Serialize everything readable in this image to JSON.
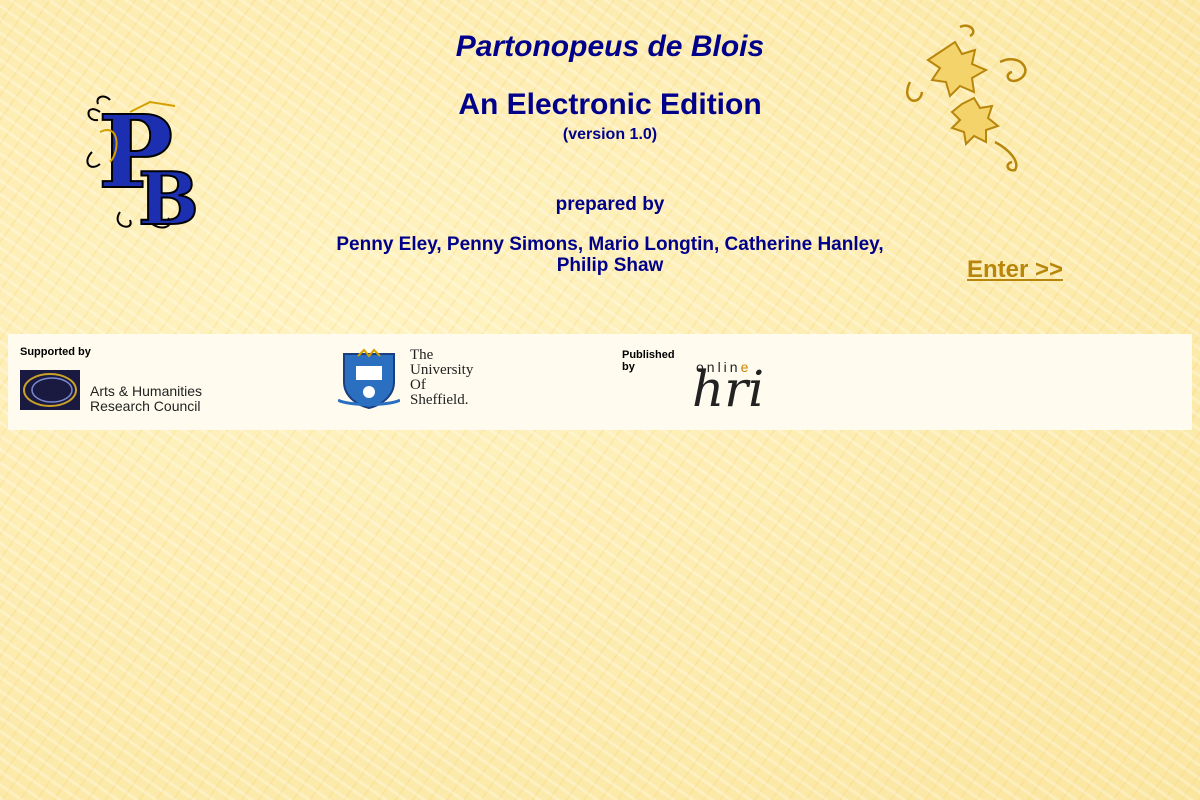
{
  "header": {
    "title": "Partonopeus de Blois",
    "subtitle": "An Electronic Edition",
    "version": "(version 1.0)",
    "prepared_by": "prepared by",
    "authors_line1": "Penny Eley, Penny Simons, Mario Longtin, Catherine Hanley,",
    "authors_line2": "Philip Shaw"
  },
  "nav": {
    "enter_label": "Enter >>"
  },
  "logos": {
    "pb": "PB",
    "vine": "vine-ornament-icon"
  },
  "footer": {
    "supported_label": "Supported by",
    "ahrc_line1": "Arts & Humanities",
    "ahrc_line2": "Research Council",
    "sheffield_line1": "The",
    "sheffield_line2": "University",
    "sheffield_line3": "Of",
    "sheffield_line4": "Sheffield.",
    "published_label_1": "Published",
    "published_label_2": "by",
    "hri_online_prefix": "onlin",
    "hri_online_suffix": "e",
    "hri_logo": "hri"
  },
  "colors": {
    "title": "#00008b",
    "enter_link": "#b8860b",
    "background": "#fdeeb0"
  }
}
